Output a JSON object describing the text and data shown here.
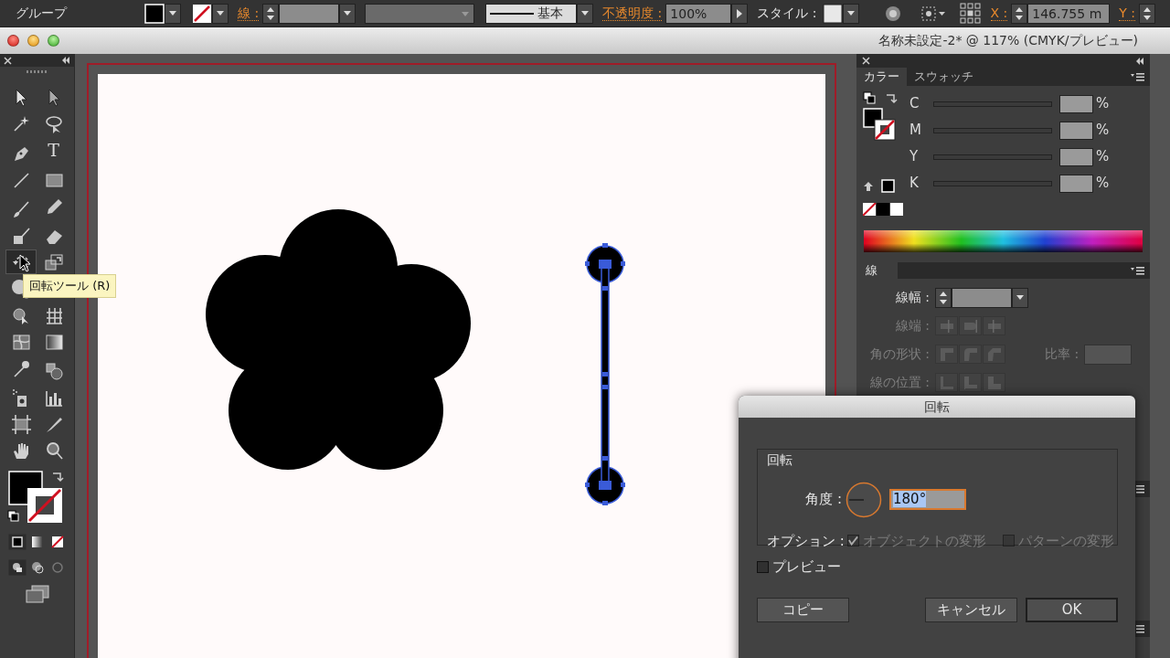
{
  "control_bar": {
    "selection_label": "グループ",
    "stroke_label": "線 :",
    "brush": "基本",
    "opacity_label": "不透明度 :",
    "opacity": "100%",
    "style_label": "スタイル :",
    "x_label": "X :",
    "x_value": "146.755 m",
    "y_label": "Y :"
  },
  "window": {
    "title": "名称未設定-2* @ 117% (CMYK/プレビュー)"
  },
  "tools": [
    {
      "kind": "selection",
      "selected": false
    },
    {
      "kind": "direct",
      "selected": false
    },
    {
      "kind": "wand",
      "selected": false
    },
    {
      "kind": "lasso",
      "selected": false
    },
    {
      "kind": "pen",
      "selected": false
    },
    {
      "kind": "type",
      "glyph": "T",
      "selected": false
    },
    {
      "kind": "line",
      "selected": false
    },
    {
      "kind": "rect",
      "selected": false
    },
    {
      "kind": "brush",
      "selected": false
    },
    {
      "kind": "pencil",
      "selected": false
    },
    {
      "kind": "blob",
      "selected": false
    },
    {
      "kind": "eraser",
      "selected": false
    },
    {
      "kind": "rotate",
      "selected": true
    },
    {
      "kind": "scale",
      "selected": false
    },
    {
      "kind": "warp",
      "selected": false
    },
    {
      "kind": "shapebuilder",
      "selected": false
    },
    {
      "kind": "perspective",
      "selected": false
    },
    {
      "kind": "mesh",
      "selected": false
    },
    {
      "kind": "gradient",
      "selected": false
    },
    {
      "kind": "eyedropper",
      "selected": false
    },
    {
      "kind": "blend",
      "selected": false
    },
    {
      "kind": "spray",
      "selected": false
    },
    {
      "kind": "graph",
      "selected": false
    },
    {
      "kind": "artboard",
      "selected": false
    },
    {
      "kind": "slice",
      "selected": false
    },
    {
      "kind": "hand",
      "selected": false
    },
    {
      "kind": "zoom",
      "selected": false
    }
  ],
  "tooltip": "回転ツール (R)",
  "color_panel": {
    "tabs": [
      {
        "label": "カラー",
        "selected": true
      },
      {
        "label": "スウォッチ",
        "selected": false
      }
    ],
    "channels": [
      {
        "name": "C",
        "unit": "%"
      },
      {
        "name": "M",
        "unit": "%"
      },
      {
        "name": "Y",
        "unit": "%"
      },
      {
        "name": "K",
        "unit": "%"
      }
    ]
  },
  "stroke_panel": {
    "title": "線",
    "weight_label": "線幅 :",
    "rows": [
      {
        "kind": "cap",
        "label": "線端 :",
        "disabled": true
      },
      {
        "kind": "corner",
        "label": "角の形状 :",
        "disabled": true
      },
      {
        "kind": "align",
        "label": "線の位置 :",
        "disabled": true
      }
    ],
    "ratio": {
      "label": "比率 :",
      "disabled": true
    }
  },
  "dialog": {
    "title": "回転",
    "group_label": "回転",
    "angle_label": "角度 :",
    "angle": "180°",
    "options_label": "オプション :",
    "options": [
      {
        "label": "オブジェクトの変形",
        "checked": true,
        "disabled": true
      },
      {
        "label": "パターンの変形",
        "checked": false,
        "disabled": true
      }
    ],
    "preview": {
      "label": "プレビュー",
      "checked": false
    },
    "buttons": [
      {
        "label": "コピー",
        "default": false
      },
      {
        "label": "キャンセル",
        "default": false
      },
      {
        "label": "OK",
        "default": true
      }
    ]
  }
}
